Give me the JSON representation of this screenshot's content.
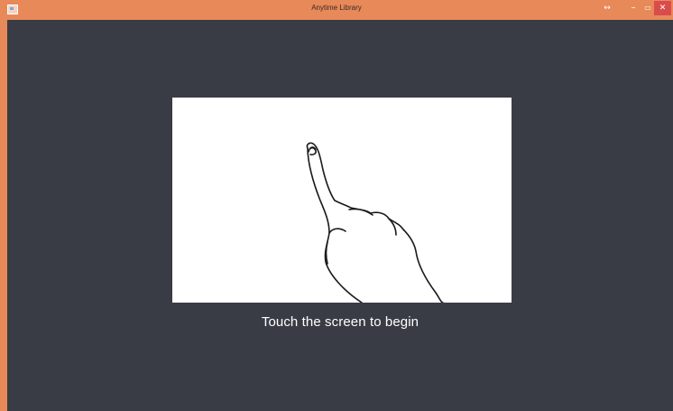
{
  "window": {
    "title": "Anytime Library",
    "controls": {
      "resize_icon": "double-arrow-icon",
      "minimize_icon": "minimize-icon",
      "maximize_icon": "maximize-icon",
      "close_icon": "close-icon",
      "resize_glyph": "↔",
      "minimize_glyph": "–",
      "maximize_glyph": "▭",
      "close_glyph": "✕"
    }
  },
  "main": {
    "illustration": "pointing-hand-illustration",
    "prompt": "Touch the screen to begin"
  },
  "colors": {
    "titlebar": "#e8895a",
    "background": "#393c44",
    "close_button": "#d94c4c",
    "prompt_text": "#ffffff"
  }
}
